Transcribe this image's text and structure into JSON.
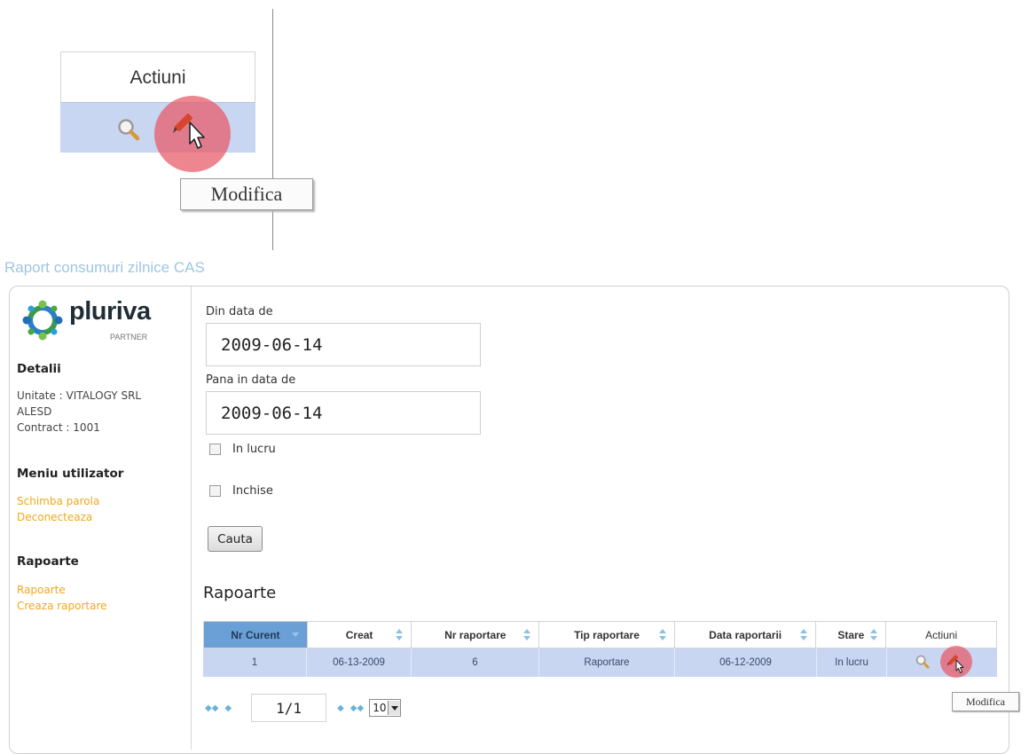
{
  "zoom_inset": {
    "header": "Actiuni",
    "tooltip": "Modifica"
  },
  "page": {
    "title": "Raport consumuri zilnice CAS"
  },
  "logo": {
    "name": "pluriva",
    "subtitle": "PARTNER"
  },
  "sidebar": {
    "details_heading": "Detalii",
    "unit_line1": "Unitate : VITALOGY SRL",
    "unit_line2": "ALESD",
    "contract": "Contract : 1001",
    "user_menu_heading": "Meniu utilizator",
    "user_menu_links": [
      "Schimba parola",
      "Deconecteaza"
    ],
    "reports_heading": "Rapoarte",
    "reports_links": [
      "Rapoarte",
      "Creaza raportare"
    ]
  },
  "form": {
    "from_label": "Din data de",
    "from_value": "2009-06-14",
    "to_label": "Pana in data de",
    "to_value": "2009-06-14",
    "checkbox_in_lucru": "In lucru",
    "checkbox_inchise": "Inchise",
    "search_button": "Cauta"
  },
  "reports": {
    "title": "Rapoarte",
    "columns": [
      "Nr Curent",
      "Creat",
      "Nr raportare",
      "Tip raportare",
      "Data raportarii",
      "Stare",
      "Actiuni"
    ],
    "rows": [
      [
        "1",
        "06-13-2009",
        "6",
        "Raportare",
        "06-12-2009",
        "In lucru"
      ]
    ],
    "action_tooltip": "Modifica"
  },
  "pager": {
    "page": "1/1",
    "page_size": "10"
  },
  "colors": {
    "link": "#f0a81c",
    "title": "#9ec6e0",
    "selected_row": "#c8d6f2",
    "active_header": "#6aa0d6",
    "highlight": "#e85864"
  }
}
